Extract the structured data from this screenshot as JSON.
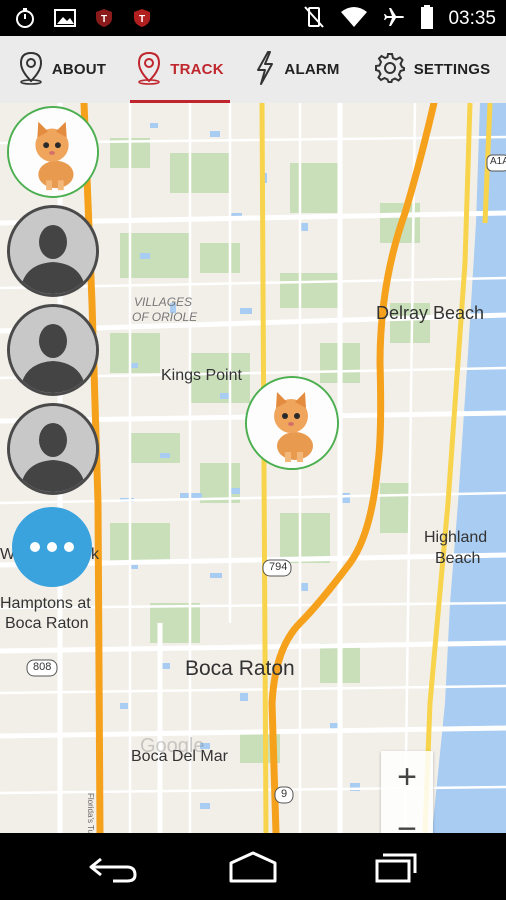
{
  "status_bar": {
    "time": "03:35",
    "left_icons": [
      "stopwatch-icon",
      "image-icon",
      "shield-icon",
      "shield-icon"
    ],
    "right_icons": [
      "no-vibrate-icon",
      "wifi-icon",
      "airplane-icon",
      "battery-icon"
    ]
  },
  "tabs": [
    {
      "label": "ABOUT",
      "icon": "map-pin-icon"
    },
    {
      "label": "TRACK",
      "icon": "map-pin-icon",
      "active": true
    },
    {
      "label": "ALARM",
      "icon": "lightning-icon"
    },
    {
      "label": "SETTINGS",
      "icon": "gear-icon"
    }
  ],
  "map": {
    "labels": {
      "delray": "Delray Beach",
      "villages1": "VILLAGES",
      "villages2": "OF ORIOLE",
      "kings": "Kings Point",
      "highland1": "Highland",
      "highland2": "Beach",
      "hamptons1": "Hamptons at",
      "hamptons2": "Boca Raton",
      "boca": "Boca Raton",
      "bocadelmar": "Boca Del Mar",
      "partial": "W",
      "partial2": "k",
      "google": "Google",
      "turnpike": "Florida's Turnpike"
    },
    "shields": {
      "r794": "794",
      "r808": "808",
      "r9": "9",
      "a1a": "A1A"
    }
  },
  "zoom": {
    "plus": "+",
    "minus": "−"
  },
  "colors": {
    "accent": "#c0262d",
    "highway": "#f5a11c",
    "water": "#a8ccf2",
    "more_button": "#3aa3de"
  }
}
